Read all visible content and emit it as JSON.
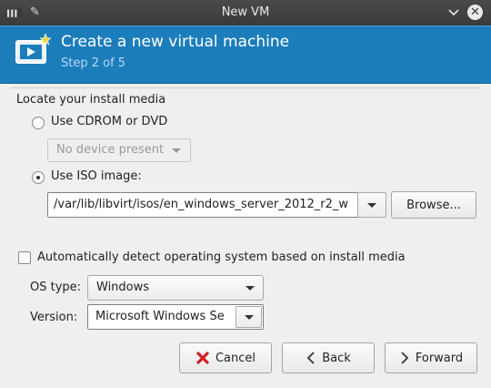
{
  "window": {
    "title": "New VM"
  },
  "header": {
    "title": "Create a new virtual machine",
    "step": "Step 2 of 5"
  },
  "install_media": {
    "section_label": "Locate your install media",
    "cdrom": {
      "label": "Use CDROM or DVD",
      "selected": false,
      "device_value": "No device present"
    },
    "iso": {
      "label": "Use ISO image:",
      "selected": true,
      "path": "/var/lib/libvirt/isos/en_windows_server_2012_r2_w",
      "browse_label": "Browse..."
    }
  },
  "os_detection": {
    "auto_detect_label": "Automatically detect operating system based on install media",
    "auto_detect_checked": false,
    "os_type_label": "OS type:",
    "os_type_value": "Windows",
    "version_label": "Version:",
    "version_value": "Microsoft Windows Se"
  },
  "buttons": {
    "cancel": "Cancel",
    "back": "Back",
    "forward": "Forward"
  },
  "colors": {
    "header_bg": "#1c7dbb",
    "titlebar_bg": "#404040",
    "cancel_icon": "#d21f1f"
  },
  "icons": {
    "app": "vm-manager-icon",
    "pin": "pin-icon",
    "minimize": "chevron-down-icon",
    "close": "close-icon",
    "header": "virtual-machine-icon",
    "cancel": "cancel-x-icon",
    "back": "chevron-left-icon",
    "forward": "chevron-right-icon"
  }
}
